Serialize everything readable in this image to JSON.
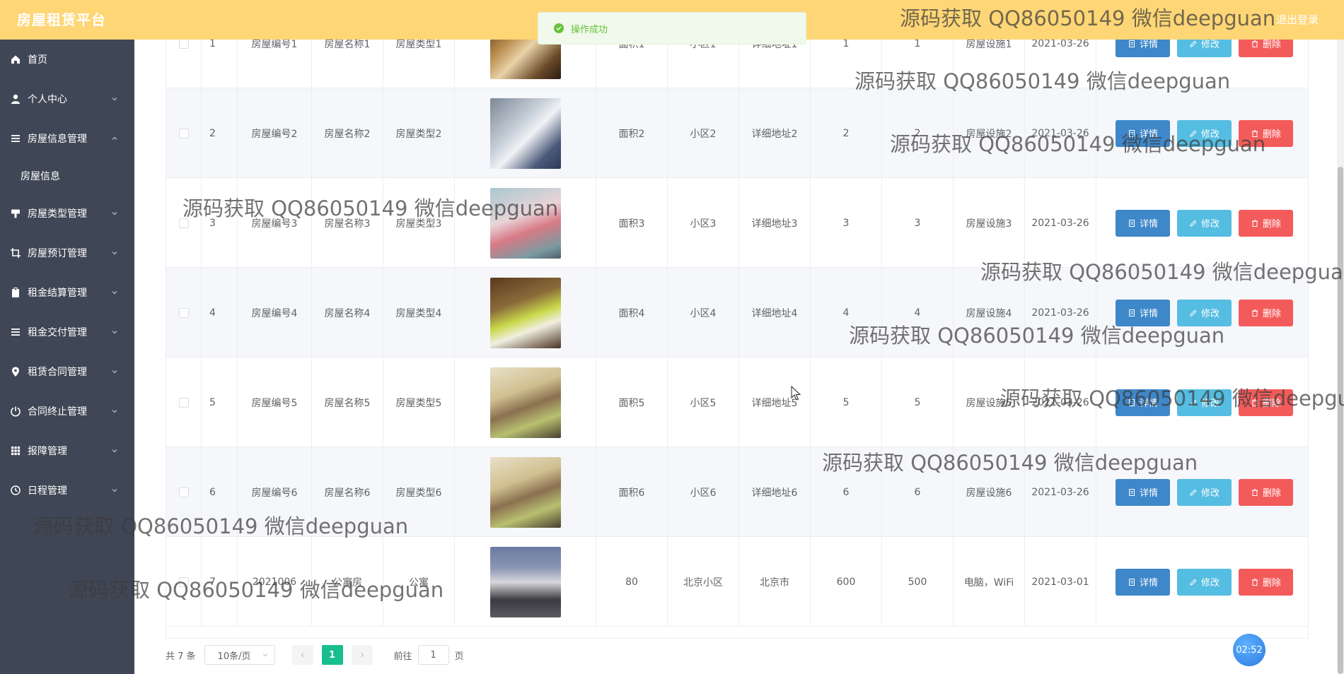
{
  "app": {
    "title": "房屋租赁平台",
    "logout": "退出登录"
  },
  "toast": {
    "message": "操作成功"
  },
  "sidebar": {
    "items": [
      {
        "label": "首页",
        "icon": "home-icon",
        "expandable": false
      },
      {
        "label": "个人中心",
        "icon": "user-icon",
        "expandable": true
      },
      {
        "label": "房屋信息管理",
        "icon": "menu-icon",
        "expandable": true,
        "expanded": true
      },
      {
        "label": "房屋类型管理",
        "icon": "tag-icon",
        "expandable": true
      },
      {
        "label": "房屋预订管理",
        "icon": "crop-icon",
        "expandable": true
      },
      {
        "label": "租金结算管理",
        "icon": "clipboard-icon",
        "expandable": true
      },
      {
        "label": "租金交付管理",
        "icon": "menu-icon",
        "expandable": true
      },
      {
        "label": "租赁合同管理",
        "icon": "location-icon",
        "expandable": true
      },
      {
        "label": "合同终止管理",
        "icon": "power-icon",
        "expandable": true
      },
      {
        "label": "报障管理",
        "icon": "grid-icon",
        "expandable": true
      },
      {
        "label": "日程管理",
        "icon": "clock-icon",
        "expandable": true
      }
    ],
    "submenu": {
      "label": "房屋信息"
    }
  },
  "table": {
    "actions": {
      "detail": "详情",
      "edit": "修改",
      "delete": "删除"
    },
    "rows": [
      {
        "index": "1",
        "code": "房屋编号1",
        "name": "房屋名称1",
        "type": "房屋类型1",
        "image": "living-room-photo",
        "area": "面积1",
        "community": "小区1",
        "address": "详细地址1",
        "c1": "1",
        "c2": "1",
        "facilities": "房屋设施1",
        "date": "2021-03-26"
      },
      {
        "index": "2",
        "code": "房屋编号2",
        "name": "房屋名称2",
        "type": "房屋类型2",
        "image": "bedroom-photo",
        "area": "面积2",
        "community": "小区2",
        "address": "详细地址2",
        "c1": "2",
        "c2": "2",
        "facilities": "房屋设施2",
        "date": "2021-03-26"
      },
      {
        "index": "3",
        "code": "房屋编号3",
        "name": "房屋名称3",
        "type": "房屋类型3",
        "image": "kids-bedroom-photo",
        "area": "面积3",
        "community": "小区3",
        "address": "详细地址3",
        "c1": "3",
        "c2": "3",
        "facilities": "房屋设施3",
        "date": "2021-03-26"
      },
      {
        "index": "4",
        "code": "房屋编号4",
        "name": "房屋名称4",
        "type": "房屋类型4",
        "image": "hotel-bedroom-photo",
        "area": "面积4",
        "community": "小区4",
        "address": "详细地址4",
        "c1": "4",
        "c2": "4",
        "facilities": "房屋设施4",
        "date": "2021-03-26"
      },
      {
        "index": "5",
        "code": "房屋编号5",
        "name": "房屋名称5",
        "type": "房屋类型5",
        "image": "apartment-photo",
        "area": "面积5",
        "community": "小区5",
        "address": "详细地址5",
        "c1": "5",
        "c2": "5",
        "facilities": "房屋设施5",
        "date": "2021-03-26"
      },
      {
        "index": "6",
        "code": "房屋编号6",
        "name": "房屋名称6",
        "type": "房屋类型6",
        "image": "apartment-photo",
        "area": "面积6",
        "community": "小区6",
        "address": "详细地址6",
        "c1": "6",
        "c2": "6",
        "facilities": "房屋设施6",
        "date": "2021-03-26"
      },
      {
        "index": "7",
        "code": "2021006",
        "name": "公寓房",
        "type": "公寓",
        "image": "building-exterior-photo",
        "area": "80",
        "community": "北京小区",
        "address": "北京市",
        "c1": "600",
        "c2": "500",
        "facilities": "电脑，WiFi",
        "date": "2021-03-01"
      }
    ]
  },
  "pagination": {
    "total": "共 7 条",
    "page_size": "10条/页",
    "current": "1",
    "goto_prefix": "前往",
    "goto_value": "1",
    "goto_suffix": "页"
  },
  "timer": {
    "label": "02:52"
  },
  "watermark": {
    "text": "源码获取 QQ86050149 微信deepguan"
  },
  "colors": {
    "topbar": "#ffd676",
    "sidebar": "#3f4756",
    "detail_button": "#3e87c9",
    "edit_button": "#55bde1",
    "delete_button": "#f35b5b",
    "page_active": "#19be8f",
    "toast_text": "#67c23a"
  }
}
